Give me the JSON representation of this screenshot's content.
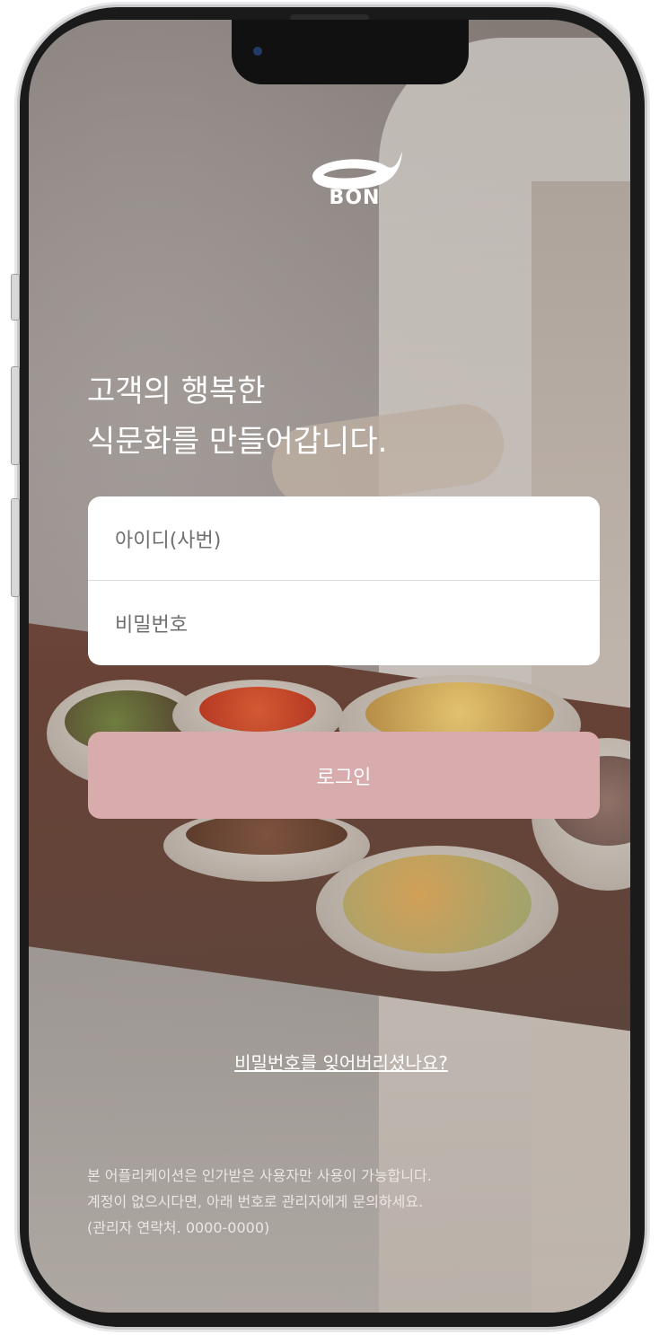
{
  "brand": {
    "logo_text": "BON",
    "accent_color": "#d8abac"
  },
  "headline": {
    "line1": "고객의 행복한",
    "line2": "식문화를 만들어갑니다."
  },
  "login_form": {
    "id_placeholder": "아이디(사번)",
    "password_placeholder": "비밀번호",
    "login_label": "로그인"
  },
  "forgot_password_link": "비밀번호를 잊어버리셨나요?",
  "notice": {
    "line1": "본 어플리케이션은 인가받은 사용자만 사용이 가능합니다.",
    "line2": "계정이 없으시다면, 아래 번호로 관리자에게 문의하세요.",
    "line3": "(관리자 연락처. 0000-0000)"
  }
}
